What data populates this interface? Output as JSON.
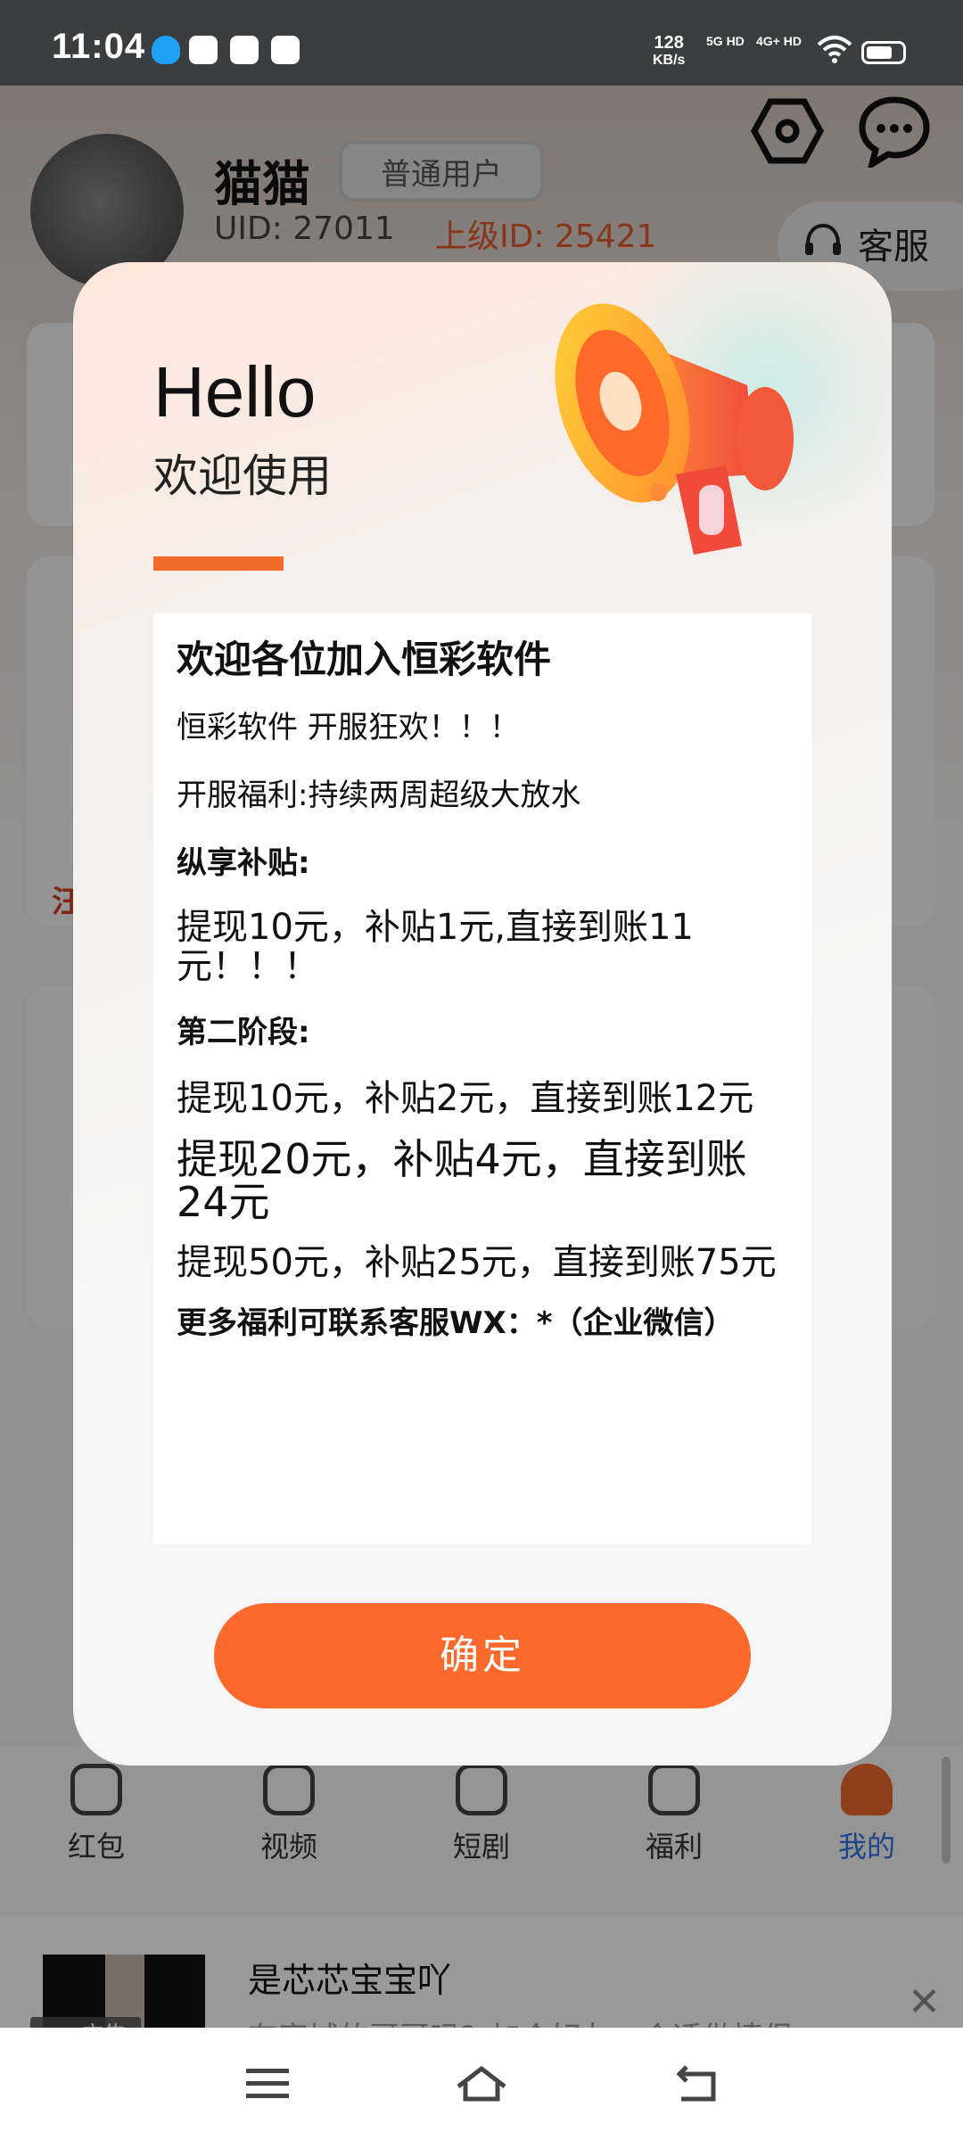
{
  "status_bar": {
    "time": "11:04",
    "rate_top": "128",
    "rate_unit": "KB/s",
    "net1": "5G HD",
    "net2": "4G+ HD"
  },
  "profile": {
    "username": "猫猫",
    "user_type": "普通用户",
    "uid": "UID: 27011",
    "parent_id": "上级ID: 25421",
    "service_label": "客服"
  },
  "background_fragments": {
    "left_char": "汪"
  },
  "tabs": [
    {
      "label": "红包",
      "icon": "red-envelope-icon"
    },
    {
      "label": "视频",
      "icon": "video-icon"
    },
    {
      "label": "短剧",
      "icon": "tv-icon"
    },
    {
      "label": "福利",
      "icon": "gift-icon"
    },
    {
      "label": "我的",
      "icon": "person-icon",
      "active": true
    }
  ],
  "ad": {
    "tag": "广告",
    "title": "是芯芯宝宝吖",
    "description": "有宣城的哥哥吗？加个好友，合适做情侣，…"
  },
  "dialog": {
    "hello": "Hello",
    "welcome": "欢迎使用",
    "content": {
      "title": "欢迎各位加入恒彩软件",
      "line1": "恒彩软件 开服狂欢！！！",
      "line2": "开服福利:持续两周超级大放水",
      "subsidy_heading": "纵享补贴:",
      "subsidy_line": "提现10元，补贴1元,直接到账11元！！！",
      "phase2_heading": "第二阶段:",
      "phase2_line1": "提现10元，补贴2元，直接到账12元",
      "phase2_line2": "提现20元，补贴4元，直接到账24元",
      "phase2_line3": "提现50元，补贴25元，直接到账75元",
      "contact": "更多福利可联系客服WX：*（企业微信）"
    },
    "confirm_label": "确定"
  },
  "colors": {
    "accent": "#FB6A2C",
    "tab_active": "#2D73E6",
    "parent_id": "#E05A2A"
  }
}
